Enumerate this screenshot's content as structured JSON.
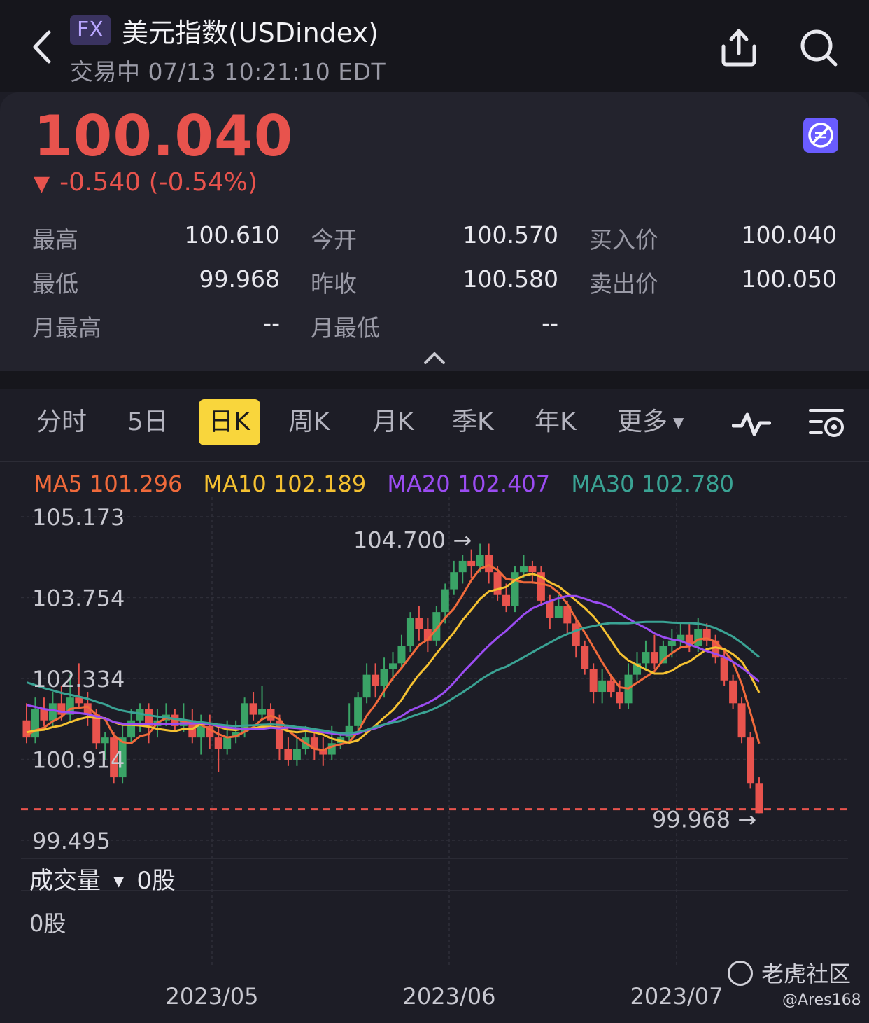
{
  "header": {
    "badge": "FX",
    "title": "美元指数(USDindex)",
    "subtitle": "交易中 07/13 10:21:10 EDT"
  },
  "quote": {
    "price": "100.040",
    "change": "-0.540 (-0.54%)",
    "stats": [
      [
        {
          "label": "最高",
          "value": "100.610"
        },
        {
          "label": "今开",
          "value": "100.570"
        },
        {
          "label": "买入价",
          "value": "100.040"
        }
      ],
      [
        {
          "label": "最低",
          "value": "99.968"
        },
        {
          "label": "昨收",
          "value": "100.580"
        },
        {
          "label": "卖出价",
          "value": "100.050"
        }
      ],
      [
        {
          "label": "月最高",
          "value": "--"
        },
        {
          "label": "月最低",
          "value": "--"
        }
      ]
    ]
  },
  "tabs": [
    "分时",
    "5日",
    "日K",
    "周K",
    "月K",
    "季K",
    "年K",
    "更多"
  ],
  "active_tab": "日K",
  "ma_legend": [
    {
      "label": "MA5 101.296",
      "color": "#f06a3b"
    },
    {
      "label": "MA10 102.189",
      "color": "#f5c131"
    },
    {
      "label": "MA20 102.407",
      "color": "#9b4cf2"
    },
    {
      "label": "MA30 102.780",
      "color": "#3aa394"
    }
  ],
  "volume": {
    "label": "成交量",
    "value": "0股",
    "axis_label": "0股"
  },
  "watermark": {
    "brand": "老虎社区",
    "user": "@Ares168"
  },
  "colors": {
    "up": "#3aa366",
    "down": "#e8534d",
    "accent": "#f9d63c"
  },
  "chart_data": {
    "type": "candlestick",
    "y_ticks": [
      "105.173",
      "103.754",
      "102.334",
      "100.914",
      "99.495"
    ],
    "y_tick_values": [
      105.173,
      103.754,
      102.334,
      100.914,
      99.495
    ],
    "ylim": [
      99.495,
      105.173
    ],
    "x_labels": [
      "2023/05",
      "2023/06",
      "2023/07"
    ],
    "annotations": {
      "high": "104.700",
      "low": "99.968"
    },
    "current_price_line": 100.04,
    "candles": [
      [
        101.6,
        101.3,
        101.9,
        101.2
      ],
      [
        101.3,
        101.8,
        102.0,
        101.2
      ],
      [
        101.8,
        101.6,
        102.0,
        101.5
      ],
      [
        101.6,
        101.9,
        102.1,
        101.5
      ],
      [
        101.9,
        101.7,
        102.2,
        101.6
      ],
      [
        101.7,
        102.0,
        102.4,
        101.6
      ],
      [
        102.0,
        101.9,
        102.6,
        101.8
      ],
      [
        101.9,
        101.7,
        102.1,
        101.5
      ],
      [
        101.7,
        101.2,
        101.8,
        101.1
      ],
      [
        101.2,
        101.3,
        101.4,
        100.9
      ],
      [
        101.3,
        100.6,
        101.4,
        100.5
      ],
      [
        100.6,
        101.3,
        101.5,
        100.5
      ],
      [
        101.3,
        101.6,
        101.8,
        101.2
      ],
      [
        101.6,
        101.8,
        101.9,
        101.4
      ],
      [
        101.8,
        101.5,
        101.9,
        101.2
      ],
      [
        101.5,
        101.6,
        101.8,
        101.3
      ],
      [
        101.6,
        101.7,
        101.9,
        101.5
      ],
      [
        101.7,
        101.5,
        101.8,
        101.4
      ],
      [
        101.5,
        101.6,
        101.9,
        101.4
      ],
      [
        101.6,
        101.3,
        101.8,
        101.2
      ],
      [
        101.3,
        101.5,
        101.7,
        101.0
      ],
      [
        101.5,
        101.3,
        101.7,
        101.1
      ],
      [
        101.3,
        101.1,
        101.5,
        100.7
      ],
      [
        101.1,
        101.3,
        101.6,
        101.0
      ],
      [
        101.3,
        101.4,
        101.6,
        101.2
      ],
      [
        101.4,
        101.9,
        102.0,
        101.3
      ],
      [
        101.9,
        101.7,
        102.1,
        101.6
      ],
      [
        101.7,
        101.8,
        102.2,
        101.6
      ],
      [
        101.8,
        101.6,
        101.9,
        101.5
      ],
      [
        101.6,
        101.1,
        101.7,
        100.9
      ],
      [
        101.1,
        100.9,
        101.3,
        100.8
      ],
      [
        100.9,
        101.1,
        101.3,
        100.8
      ],
      [
        101.1,
        101.3,
        101.5,
        101.0
      ],
      [
        101.3,
        101.1,
        101.4,
        100.9
      ],
      [
        101.1,
        101.0,
        101.3,
        100.8
      ],
      [
        101.0,
        101.2,
        101.5,
        100.9
      ],
      [
        101.2,
        101.3,
        101.4,
        101.1
      ],
      [
        101.3,
        101.5,
        101.9,
        101.2
      ],
      [
        101.5,
        102.0,
        102.1,
        101.4
      ],
      [
        102.0,
        102.4,
        102.6,
        101.9
      ],
      [
        102.4,
        102.2,
        102.6,
        102.0
      ],
      [
        102.2,
        102.5,
        102.7,
        102.0
      ],
      [
        102.5,
        102.6,
        102.8,
        102.3
      ],
      [
        102.6,
        102.9,
        103.1,
        102.5
      ],
      [
        102.9,
        103.4,
        103.5,
        102.8
      ],
      [
        103.4,
        103.2,
        103.6,
        103.0
      ],
      [
        103.2,
        103.0,
        103.4,
        102.8
      ],
      [
        103.0,
        103.5,
        103.6,
        102.9
      ],
      [
        103.5,
        103.9,
        104.0,
        103.3
      ],
      [
        103.9,
        104.2,
        104.4,
        103.8
      ],
      [
        104.2,
        104.4,
        104.5,
        104.0
      ],
      [
        104.4,
        104.3,
        104.6,
        104.1
      ],
      [
        104.3,
        104.5,
        104.7,
        104.2
      ],
      [
        104.5,
        104.2,
        104.7,
        104.0
      ],
      [
        104.2,
        103.8,
        104.3,
        103.7
      ],
      [
        103.8,
        103.6,
        104.0,
        103.5
      ],
      [
        103.6,
        104.2,
        104.3,
        103.5
      ],
      [
        104.2,
        104.3,
        104.5,
        104.1
      ],
      [
        104.3,
        104.2,
        104.4,
        104.0
      ],
      [
        104.2,
        103.7,
        104.3,
        103.6
      ],
      [
        103.7,
        103.4,
        103.8,
        103.2
      ],
      [
        103.4,
        103.6,
        103.8,
        103.4
      ],
      [
        103.6,
        103.3,
        103.7,
        103.1
      ],
      [
        103.3,
        102.9,
        103.4,
        102.7
      ],
      [
        102.9,
        102.5,
        103.0,
        102.4
      ],
      [
        102.5,
        102.1,
        102.6,
        101.9
      ],
      [
        102.1,
        102.3,
        102.5,
        101.9
      ],
      [
        102.3,
        102.1,
        102.4,
        102.0
      ],
      [
        102.1,
        101.9,
        102.3,
        101.8
      ],
      [
        101.9,
        102.4,
        102.6,
        101.8
      ],
      [
        102.4,
        102.6,
        102.8,
        102.3
      ],
      [
        102.6,
        102.8,
        103.0,
        102.5
      ],
      [
        102.8,
        102.6,
        103.1,
        102.5
      ],
      [
        102.6,
        102.9,
        103.0,
        102.6
      ],
      [
        102.9,
        103.0,
        103.2,
        102.7
      ],
      [
        103.0,
        103.1,
        103.3,
        102.9
      ],
      [
        103.1,
        102.9,
        103.3,
        102.8
      ],
      [
        102.9,
        103.2,
        103.4,
        102.8
      ],
      [
        103.2,
        103.0,
        103.3,
        102.9
      ],
      [
        103.0,
        102.7,
        103.1,
        102.6
      ],
      [
        102.7,
        102.3,
        102.8,
        102.2
      ],
      [
        102.3,
        101.9,
        102.4,
        101.8
      ],
      [
        101.9,
        101.3,
        102.0,
        101.2
      ],
      [
        101.3,
        100.5,
        101.4,
        100.4
      ],
      [
        100.5,
        99.97,
        100.6,
        99.97
      ]
    ]
  }
}
